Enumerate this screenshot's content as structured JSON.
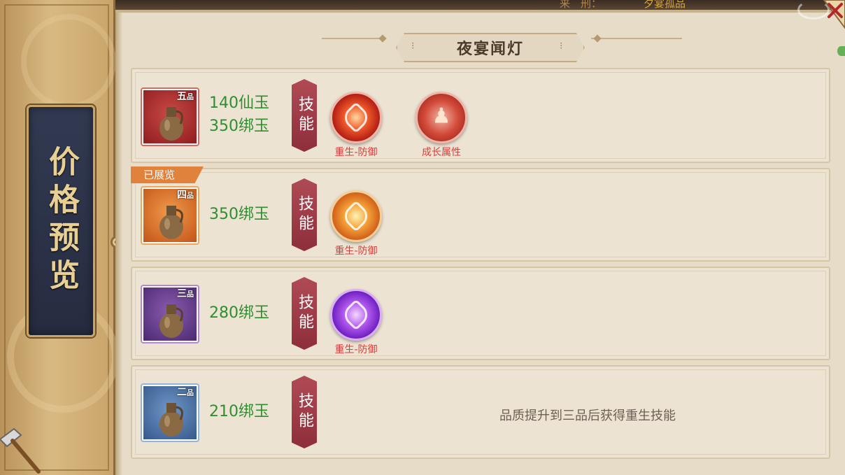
{
  "sidebar": {
    "title": "价格预览"
  },
  "header": {
    "title": "夜宴闻灯"
  },
  "top_strip": {
    "left_text": "来　刑：",
    "right_text": "夕宴孤品"
  },
  "skill_tag_label": "技能",
  "rows": [
    {
      "grade": "五",
      "grade_suffix": "品",
      "quality": "red",
      "prices": [
        "140仙玉",
        "350绑玉"
      ],
      "badge": "",
      "skills": [
        {
          "name": "重生-防御",
          "icon": "rebirth-defense-icon",
          "color": "#e03a3a"
        },
        {
          "name": "成长属性",
          "icon": "growth-attribute-icon",
          "color": "#e03a3a"
        }
      ]
    },
    {
      "grade": "四",
      "grade_suffix": "品",
      "quality": "orange",
      "prices": [
        "350绑玉"
      ],
      "badge": "已展览",
      "skills": [
        {
          "name": "重生-防御",
          "icon": "rebirth-defense-icon",
          "color": "#e03a3a"
        }
      ]
    },
    {
      "grade": "三",
      "grade_suffix": "品",
      "quality": "purple",
      "prices": [
        "280绑玉"
      ],
      "badge": "",
      "skills": [
        {
          "name": "重生-防御",
          "icon": "rebirth-defense-icon",
          "color": "#e03a3a"
        }
      ]
    },
    {
      "grade": "二",
      "grade_suffix": "品",
      "quality": "blue",
      "prices": [
        "210绑玉"
      ],
      "badge": "",
      "skills": [],
      "note": "品质提升到三品后获得重生技能"
    }
  ],
  "colors": {
    "price_green": "#2f8f2f",
    "skill_name_red": "#e03a3a",
    "badge_orange": "#e0813c",
    "panel_bg": "#e7dcc8"
  }
}
